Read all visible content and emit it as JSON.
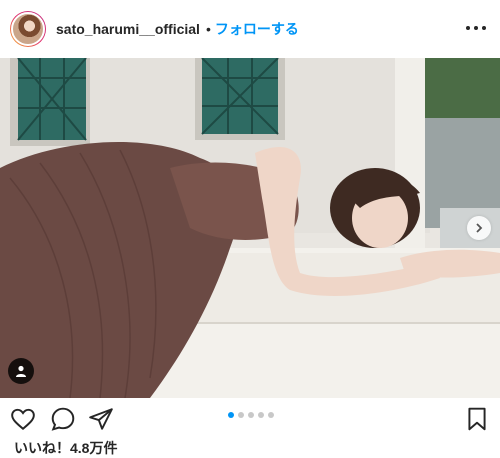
{
  "header": {
    "username": "sato_harumi__official",
    "separator": "•",
    "follow_label": "フォローする"
  },
  "post": {
    "carousel": {
      "total": 5,
      "active_index": 0
    }
  },
  "icons": {
    "like": "heart-icon",
    "comment": "comment-icon",
    "share": "share-icon",
    "save": "bookmark-icon",
    "more": "more-options-icon",
    "next": "chevron-right-icon",
    "tag": "user-tag-icon"
  },
  "likes": {
    "text": "いいね！4.8万件"
  },
  "colors": {
    "accent": "#0095f6",
    "text": "#262626"
  }
}
